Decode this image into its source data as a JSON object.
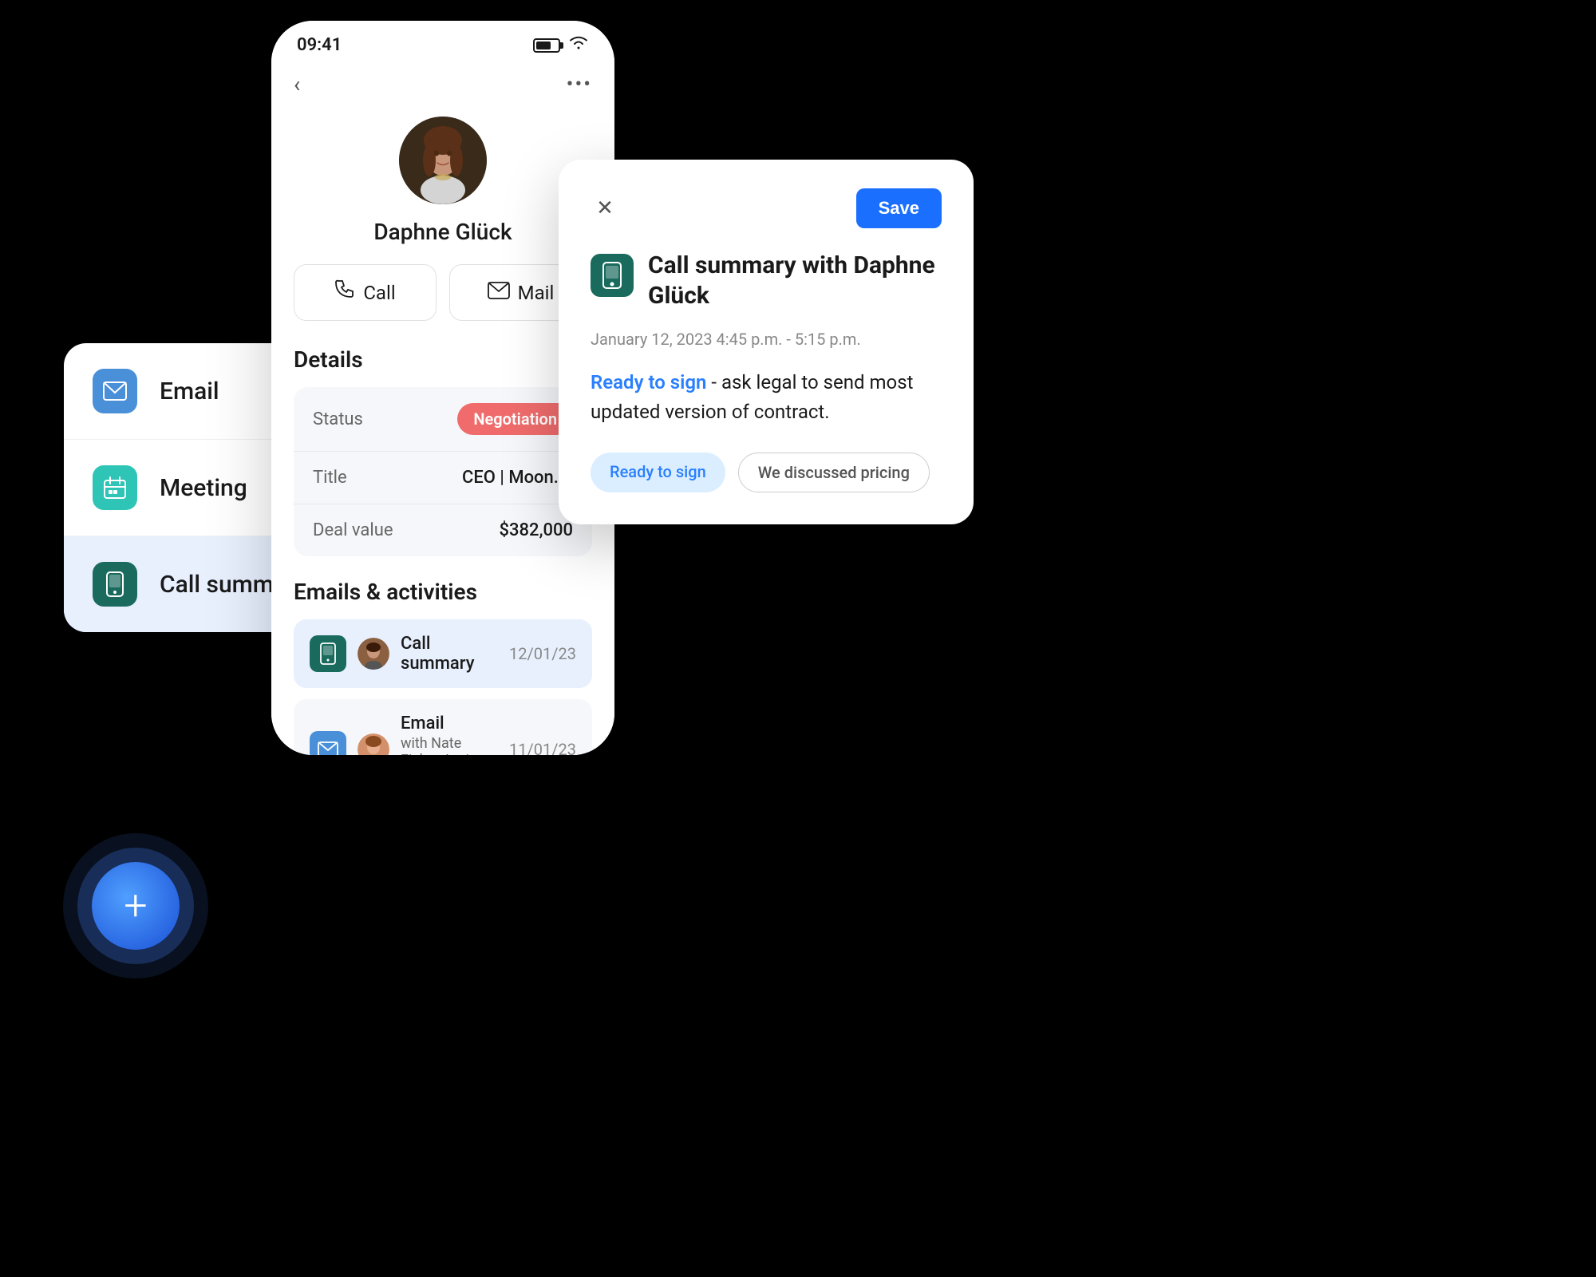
{
  "status_bar": {
    "time": "09:41",
    "battery_label": "battery",
    "wifi_label": "wifi"
  },
  "phone": {
    "back_label": "‹",
    "more_label": "•••",
    "contact_name": "Daphne Glück",
    "action_call": "Call",
    "action_mail": "Mail",
    "details_title": "Details",
    "details": {
      "status_label": "Status",
      "status_value": "Negotiation",
      "title_label": "Title",
      "title_value": "CEO | Moon.io",
      "deal_label": "Deal value",
      "deal_value": "$382,000"
    },
    "activities_title": "Emails & activities",
    "activities": [
      {
        "type": "call-summary",
        "title": "Call summary",
        "date": "12/01/23",
        "highlighted": true
      },
      {
        "type": "email",
        "title": "Email",
        "date": "11/01/23",
        "sub": "with Nate Fisher, Larissa Piker",
        "highlighted": false
      }
    ]
  },
  "left_panel": {
    "items": [
      {
        "id": "email",
        "label": "Email",
        "icon_type": "email",
        "active": false
      },
      {
        "id": "meeting",
        "label": "Meeting",
        "icon_type": "meeting",
        "active": false
      },
      {
        "id": "call-summary",
        "label": "Call summary",
        "icon_type": "call",
        "active": true
      }
    ],
    "fab_label": "+"
  },
  "popup": {
    "close_label": "✕",
    "save_label": "Save",
    "title": "Call summary with Daphne Glück",
    "datetime": "January 12, 2023  4:45 p.m. - 5:15 p.m.",
    "ready_to_sign_link": "Ready to sign",
    "body_text": " - ask legal to send most updated version of contract.",
    "tags": [
      {
        "label": "Ready to sign",
        "style": "light-blue"
      },
      {
        "label": "We discussed pricing",
        "style": "outlined"
      }
    ]
  }
}
